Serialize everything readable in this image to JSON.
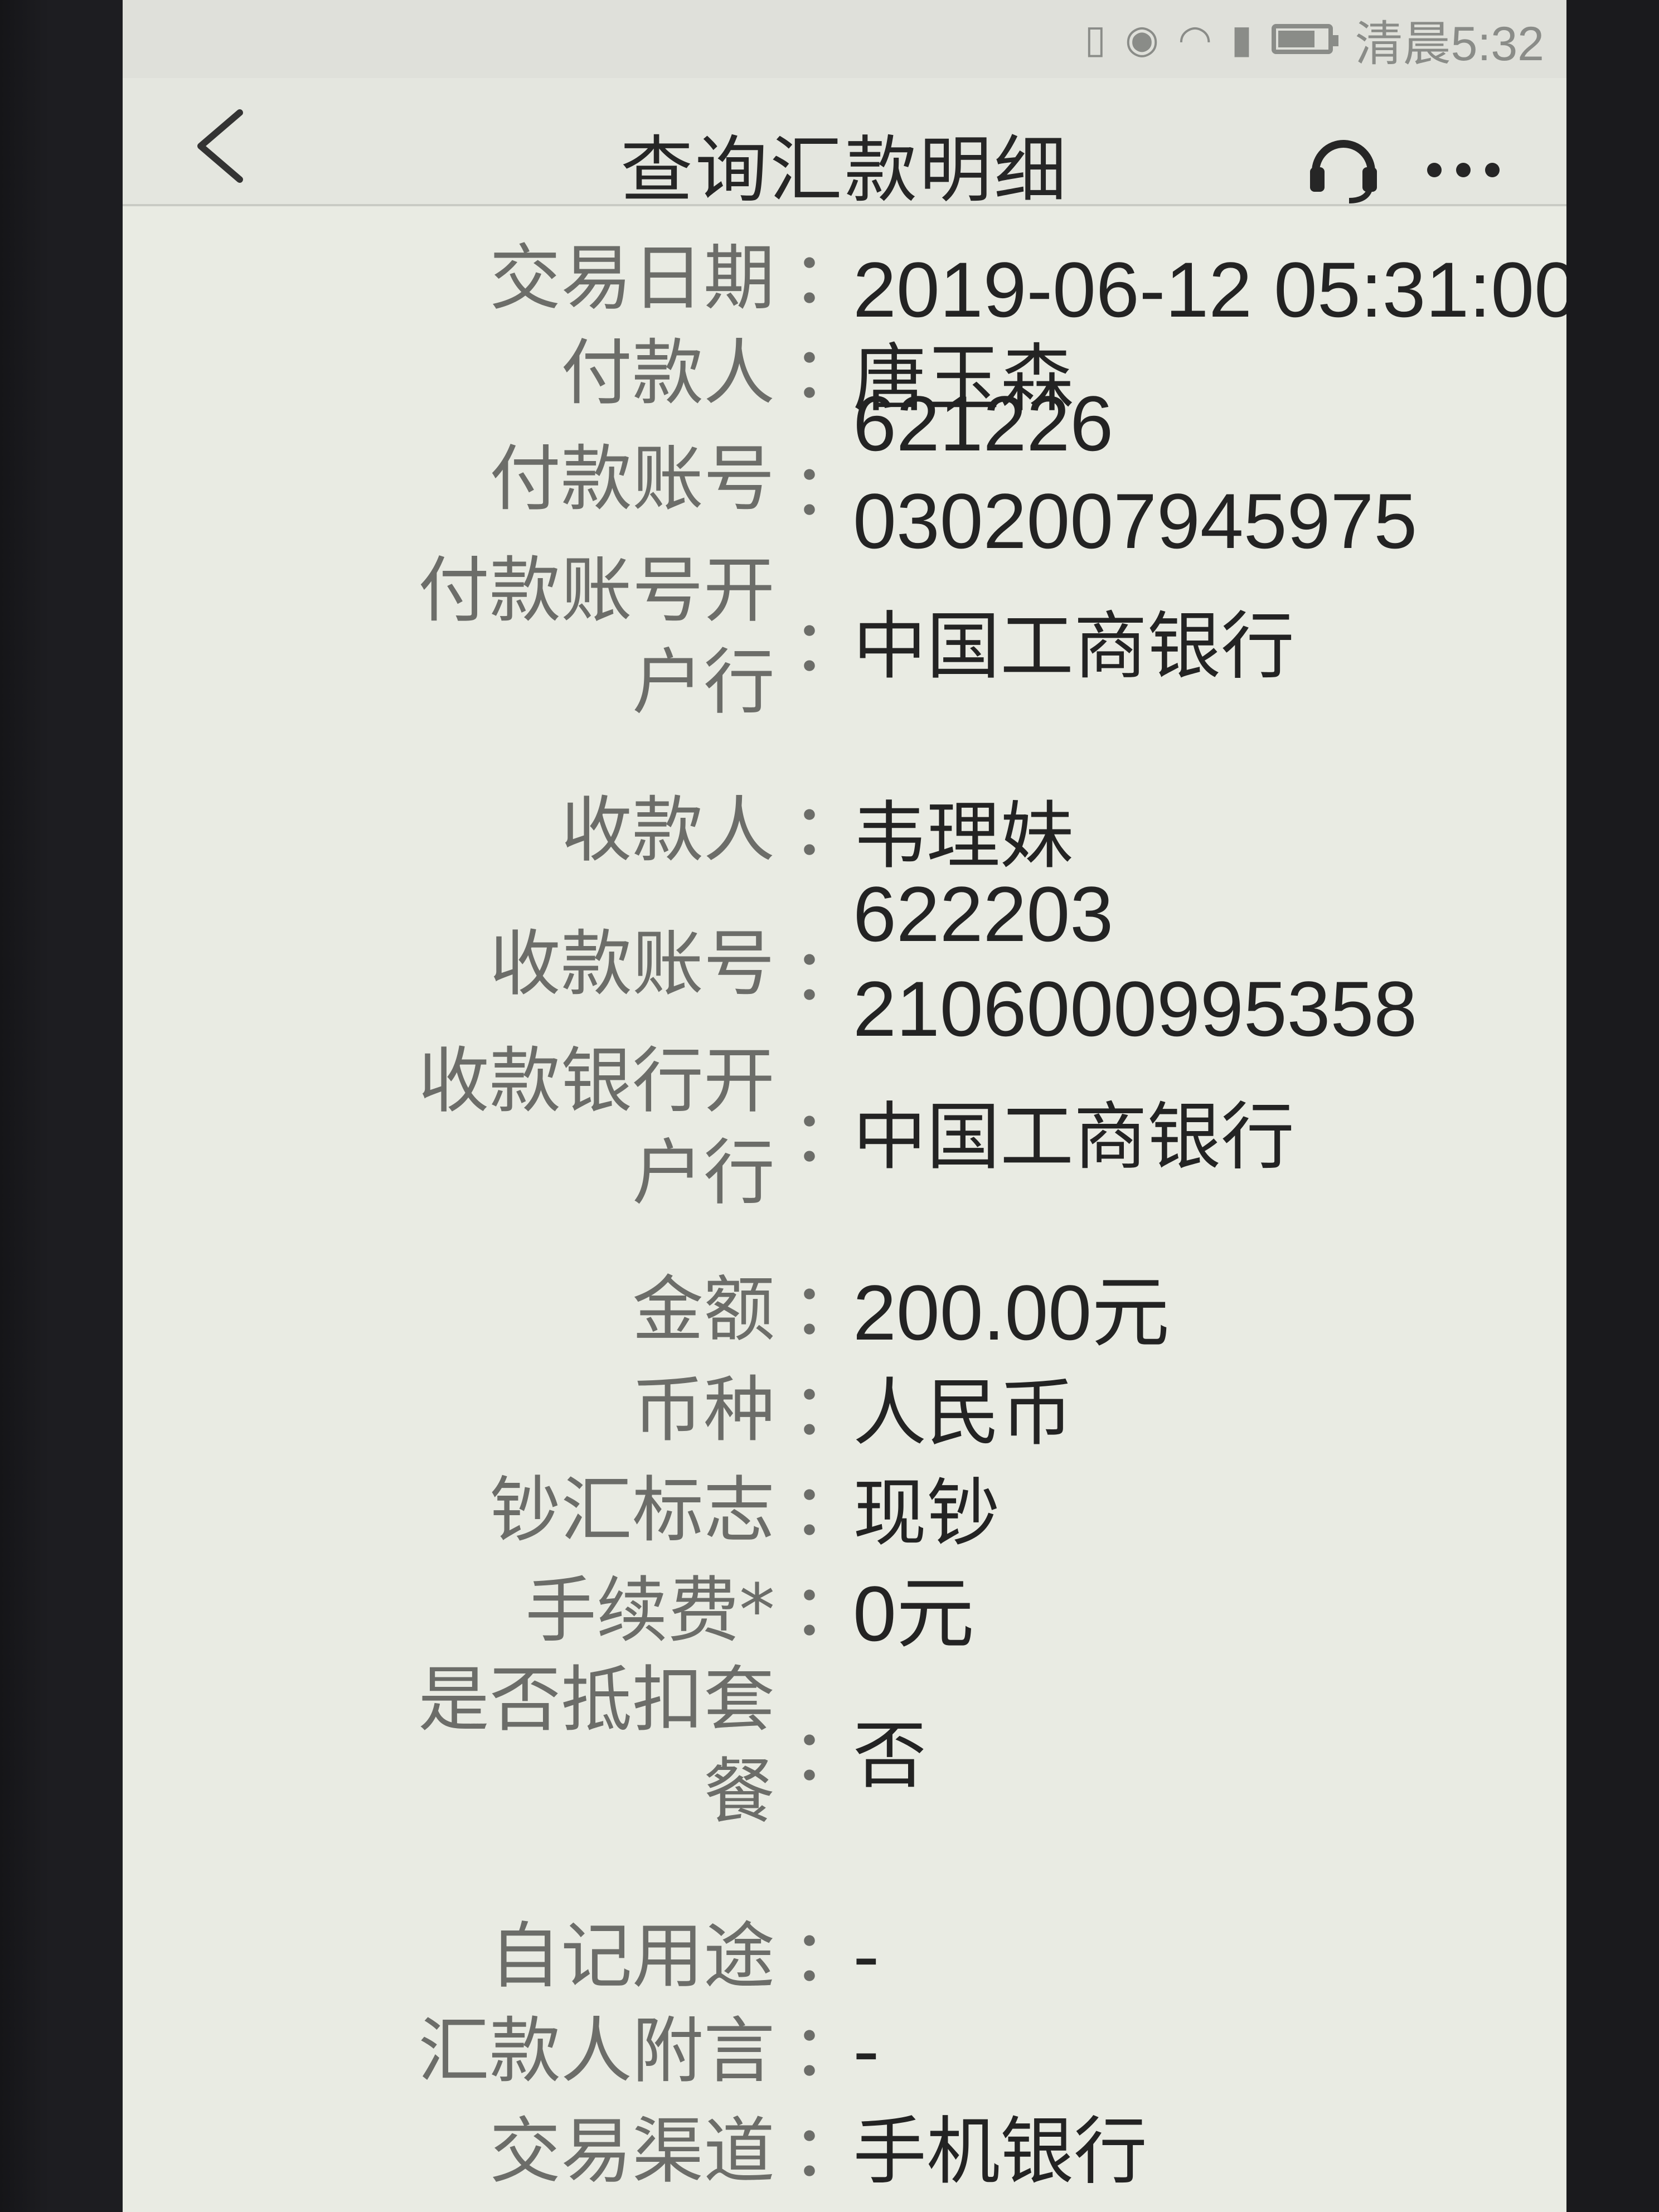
{
  "status_bar": {
    "time": "清晨5:32",
    "icons": [
      "sim-icon",
      "eye-icon",
      "wifi-icon",
      "signal-icon",
      "battery-icon"
    ]
  },
  "nav": {
    "title": "查询汇款明细",
    "back_icon": "chevron-left-icon",
    "support_icon": "headset-icon",
    "more_icon": "more-dots-icon"
  },
  "details": [
    {
      "label": "交易日期",
      "value": "2019-06-12 05:31:00"
    },
    {
      "label": "付款人",
      "value": "唐玉森"
    },
    {
      "label": "付款账号",
      "value_line1": "621226",
      "value_line2": "0302007945975"
    },
    {
      "label_line1": "付款账号开",
      "label_line2": "户行",
      "value": "中国工商银行"
    },
    {
      "label": "收款人",
      "value": "韦理妹"
    },
    {
      "label": "收款账号",
      "value_line1": "622203",
      "value_line2": "2106000995358"
    },
    {
      "label_line1": "收款银行开",
      "label_line2": "户行",
      "value": "中国工商银行"
    },
    {
      "label": "金额",
      "value": "200.00元"
    },
    {
      "label": "币种",
      "value": "人民币"
    },
    {
      "label": "钞汇标志",
      "value": "现钞"
    },
    {
      "label": "手续费*",
      "value": "0元"
    },
    {
      "label_line1": "是否抵扣套",
      "label_line2": "餐",
      "value": "否"
    },
    {
      "label": "自记用途",
      "value": "-"
    },
    {
      "label": "汇款人附言",
      "value": "-"
    },
    {
      "label": "交易渠道",
      "value": "手机银行"
    }
  ],
  "separator": "："
}
